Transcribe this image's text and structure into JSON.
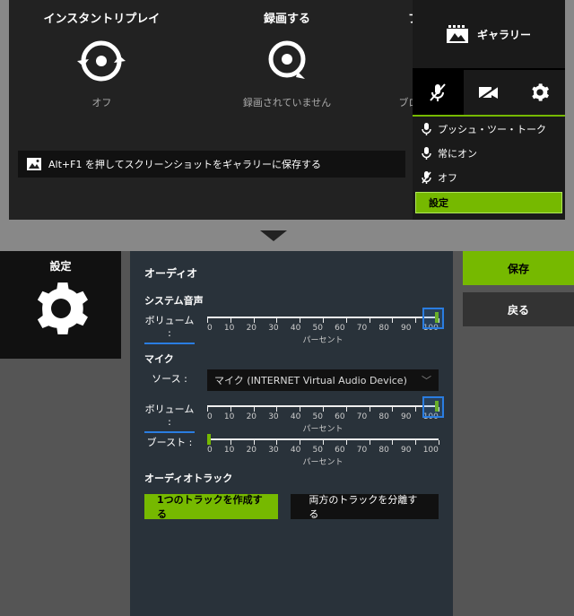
{
  "top": {
    "tiles": [
      {
        "title": "インスタントリプレイ",
        "status": "オフ"
      },
      {
        "title": "録画する",
        "status": "録画されていません"
      },
      {
        "title": "ブロードキャストライブ",
        "status": "ブロードキャストされていません"
      }
    ],
    "gallery": "ギャラリー",
    "hint": "Alt+F1 を押してスクリーンショットをギャラリーに保存する",
    "mic_menu": {
      "items": [
        "プッシュ・ツー・トーク",
        "常にオン",
        "オフ"
      ],
      "settings": "設定"
    }
  },
  "settings": {
    "sidebar": "設定",
    "header": "オーディオ",
    "system": {
      "title": "システム音声",
      "volume_label": "ボリューム :",
      "value": 100,
      "unit": "パーセント"
    },
    "mic": {
      "title": "マイク",
      "source_label": "ソース :",
      "source_value": "マイク (INTERNET Virtual Audio Device)",
      "volume_label": "ボリューム :",
      "volume_value": 100,
      "boost_label": "ブースト :",
      "boost_value": 0,
      "unit": "パーセント"
    },
    "track": {
      "title": "オーディオトラック",
      "create": "1つのトラックを作成する",
      "split": "両方のトラックを分離する"
    },
    "buttons": {
      "save": "保存",
      "back": "戻る"
    },
    "ticks": [
      "0",
      "10",
      "20",
      "30",
      "40",
      "50",
      "60",
      "70",
      "80",
      "90",
      "100"
    ]
  }
}
